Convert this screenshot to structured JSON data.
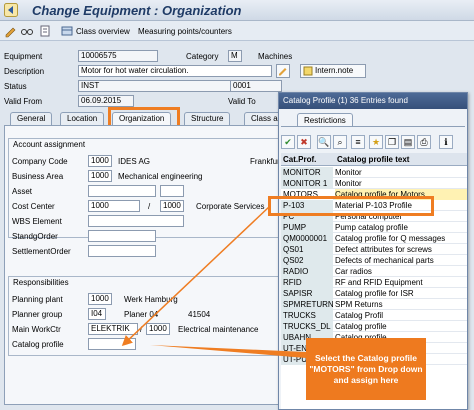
{
  "header": {
    "title": "Change Equipment : Organization"
  },
  "toolbar": {
    "class_overview": "Class overview",
    "measuring_points": "Measuring points/counters"
  },
  "fields": {
    "equipment_label": "Equipment",
    "equipment_value": "10006575",
    "category_label": "Category",
    "category_value": "M",
    "category_text": "Machines",
    "description_label": "Description",
    "description_value": "Motor for hot water circulation.",
    "intern_note": "Intern.note",
    "status_label": "Status",
    "status_value": "INST",
    "status_code": "0001",
    "valid_from_label": "Valid From",
    "valid_from_value": "06.09.2015",
    "valid_to_label": "Valid To"
  },
  "tabs": [
    "General",
    "Location",
    "Organization",
    "Structure",
    "Class a"
  ],
  "account_assignment": {
    "title": "Account assignment",
    "company_code_label": "Company Code",
    "company_code_value": "1000",
    "company_code_text": "IDES AG",
    "company_code_extra": "Frankfur",
    "business_area_label": "Business Area",
    "business_area_value": "1000",
    "business_area_text": "Mechanical engineering",
    "asset_label": "Asset",
    "cost_center_label": "Cost Center",
    "cost_center_value": "1000",
    "cost_center_value2": "1000",
    "cost_center_text": "Corporate Services",
    "wbs_label": "WBS Element",
    "standing_order_label": "StandgOrder",
    "settlement_order_label": "SettlementOrder"
  },
  "responsibilities": {
    "title": "Responsibilities",
    "planning_plant_label": "Planning plant",
    "planning_plant_value": "1000",
    "planning_plant_text": "Werk Hamburg",
    "planner_group_label": "Planner group",
    "planner_group_value": "I04",
    "planner_group_text": "Planer 04",
    "planner_group_extra": "41504",
    "main_workctr_label": "Main WorkCtr",
    "main_workctr_value": "ELEKTRIK",
    "main_workctr_plant": "1000",
    "main_workctr_text": "Electrical maintenance",
    "catalog_profile_label": "Catalog profile"
  },
  "popup": {
    "title": "Catalog Profile (1)   36 Entries found",
    "tab": "Restrictions",
    "col1": "Cat.Prof.",
    "col2": "Catalog profile text",
    "rows": [
      {
        "code": "MONITOR",
        "text": "Monitor"
      },
      {
        "code": "MONITOR 1",
        "text": "Monitor"
      },
      {
        "code": "MOTORS",
        "text": "Catalog profile for Motors"
      },
      {
        "code": "P-103",
        "text": "Material P-103 Profile"
      },
      {
        "code": "PC",
        "text": "Personal computer"
      },
      {
        "code": "PUMP",
        "text": "Pump catalog profile"
      },
      {
        "code": "QM0000001",
        "text": "Catalog profile for Q messages"
      },
      {
        "code": "QS01",
        "text": "Defect attributes for screws"
      },
      {
        "code": "QS02",
        "text": "Defects of mechanical parts"
      },
      {
        "code": "RADIO",
        "text": "Car radios"
      },
      {
        "code": "RFID",
        "text": "RF and RFID Equipment"
      },
      {
        "code": "SAPISR",
        "text": "Catalog profile for ISR"
      },
      {
        "code": "SPMRETURN",
        "text": "SPM Returns"
      },
      {
        "code": "TRUCKS",
        "text": "Catalog Profil"
      },
      {
        "code": "TRUCKS_DL",
        "text": "Catalog profile"
      },
      {
        "code": "UBAHN",
        "text": "Catalog profile"
      },
      {
        "code": "UT-ENGINE",
        "text": "Catalog profile"
      },
      {
        "code": "UT-PUMP",
        "text": "Pump catalog profile"
      }
    ]
  },
  "callout": {
    "text": "Select the Catalog profile \"MOTORS\" from Drop down and assign here"
  },
  "colors": {
    "highlight": "#ef7d22",
    "title_text": "#1f3b66"
  }
}
